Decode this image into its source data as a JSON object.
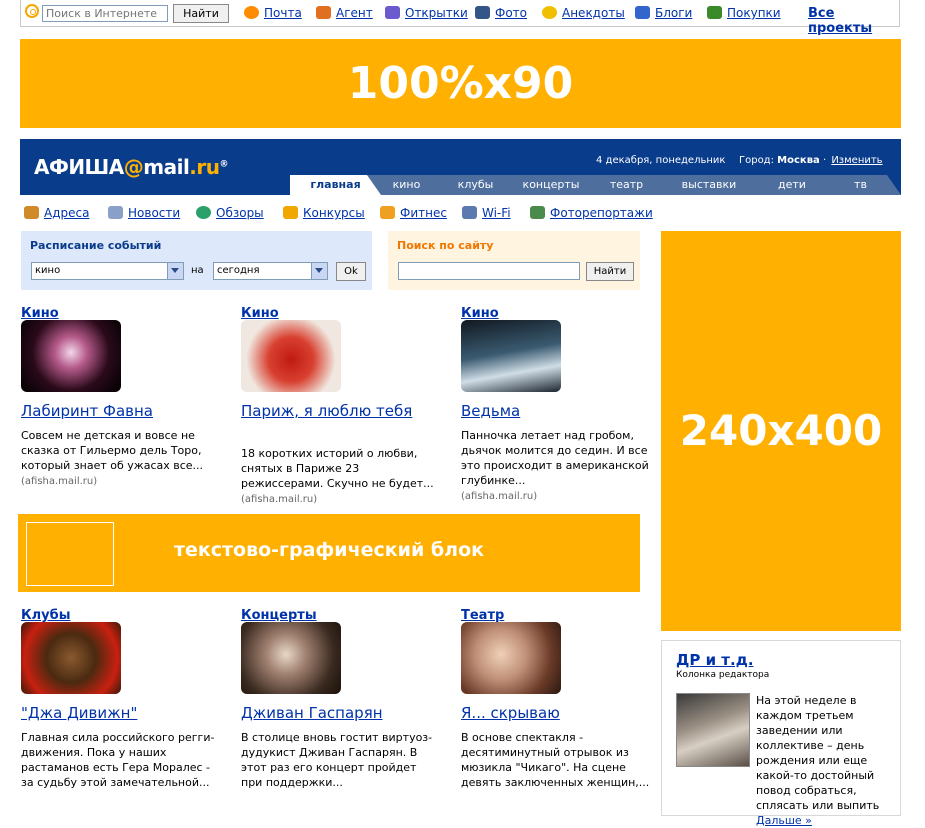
{
  "topbar": {
    "search_placeholder": "Поиск в Интернете",
    "search_button": "Найти",
    "links": [
      {
        "label": "Почта",
        "icon": "mail-at-icon",
        "color": "#ff8c00"
      },
      {
        "label": "Агент",
        "icon": "envelope-icon",
        "color": "#e07020"
      },
      {
        "label": "Открытки",
        "icon": "postcard-icon",
        "color": "#6a5acd"
      },
      {
        "label": "Фото",
        "icon": "camera-icon",
        "color": "#335588"
      },
      {
        "label": "Анекдоты",
        "icon": "smiley-icon",
        "color": "#f0c000"
      },
      {
        "label": "Блоги",
        "icon": "blog-icon",
        "color": "#3366cc"
      },
      {
        "label": "Покупки",
        "icon": "cart-icon",
        "color": "#3a8a2a"
      }
    ],
    "all_projects": "Все проекты"
  },
  "banners": {
    "top": "100%x90",
    "right": "240x400",
    "middle": "текстово-графический блок"
  },
  "header": {
    "logo_main": "АФИША",
    "logo_at": "@",
    "logo_mail": "mail",
    "logo_ru": ".ru",
    "logo_reg": "®",
    "date": "4 декабря, понедельник",
    "city_label": "Город:",
    "city": "Москва",
    "change": "Изменить",
    "tabs": [
      "главная",
      "кино",
      "клубы",
      "концерты",
      "театр",
      "выставки",
      "дети",
      "тв"
    ]
  },
  "nav": [
    {
      "label": "Адреса",
      "icon": "house-icon"
    },
    {
      "label": "Новости",
      "icon": "newspaper-icon"
    },
    {
      "label": "Обзоры",
      "icon": "disc-icon"
    },
    {
      "label": "Конкурсы",
      "icon": "trophy-icon"
    },
    {
      "label": "Фитнес",
      "icon": "runner-icon"
    },
    {
      "label": "Wi-Fi",
      "icon": "wifi-icon"
    },
    {
      "label": "Фоторепортажи",
      "icon": "photo-icon"
    }
  ],
  "schedule": {
    "title": "Расписание событий",
    "category": "кино",
    "on": "на",
    "when": "сегодня",
    "ok": "Ok"
  },
  "site_search": {
    "title": "Поиск по сайту",
    "button": "Найти"
  },
  "cards_top": [
    {
      "category": "Кино",
      "title": "Лабиринт Фавна",
      "desc": "Совсем не детская и вовсе не сказка от Гильермо дель Торо, который знает об ужасах все...",
      "source": "(afisha.mail.ru)"
    },
    {
      "category": "Кино",
      "title": "Париж, я люблю тебя",
      "desc": "18 коротких историй о любви, снятых в Париже 23 режиссерами. Скучно не будет...",
      "source": "(afisha.mail.ru)"
    },
    {
      "category": "Кино",
      "title": "Ведьма",
      "desc": "Панночка летает над гробом, дьячок молится до седин. И все это происходит в американской глубинке...",
      "source": "(afisha.mail.ru)"
    }
  ],
  "cards_bottom": [
    {
      "category": "Клубы",
      "title": "\"Джа Дивижн\"",
      "desc": "Главная сила российского регги-движения. Пока у наших растаманов есть Гера Моралес - за судьбу этой замечательной..."
    },
    {
      "category": "Концерты",
      "title": "Дживан Гаспарян",
      "desc": "В столице вновь гостит виртуоз-дудукист Дживан Гаспарян. В этот раз его концерт пройдет при поддержки..."
    },
    {
      "category": "Театр",
      "title": "Я... скрываю",
      "desc": "В основе спектакля - десятиминутный отрывок из мюзикла \"Чикаго\". На сцене девять заключенных женщин,..."
    }
  ],
  "editor": {
    "title": "ДР и т.д.",
    "subtitle": "Колонка редактора",
    "text": "На этой неделе в каждом третьем заведении или коллективе – день рождения или еще какой-то достойный повод собраться, сплясать или выпить",
    "more": "Дальше »"
  }
}
